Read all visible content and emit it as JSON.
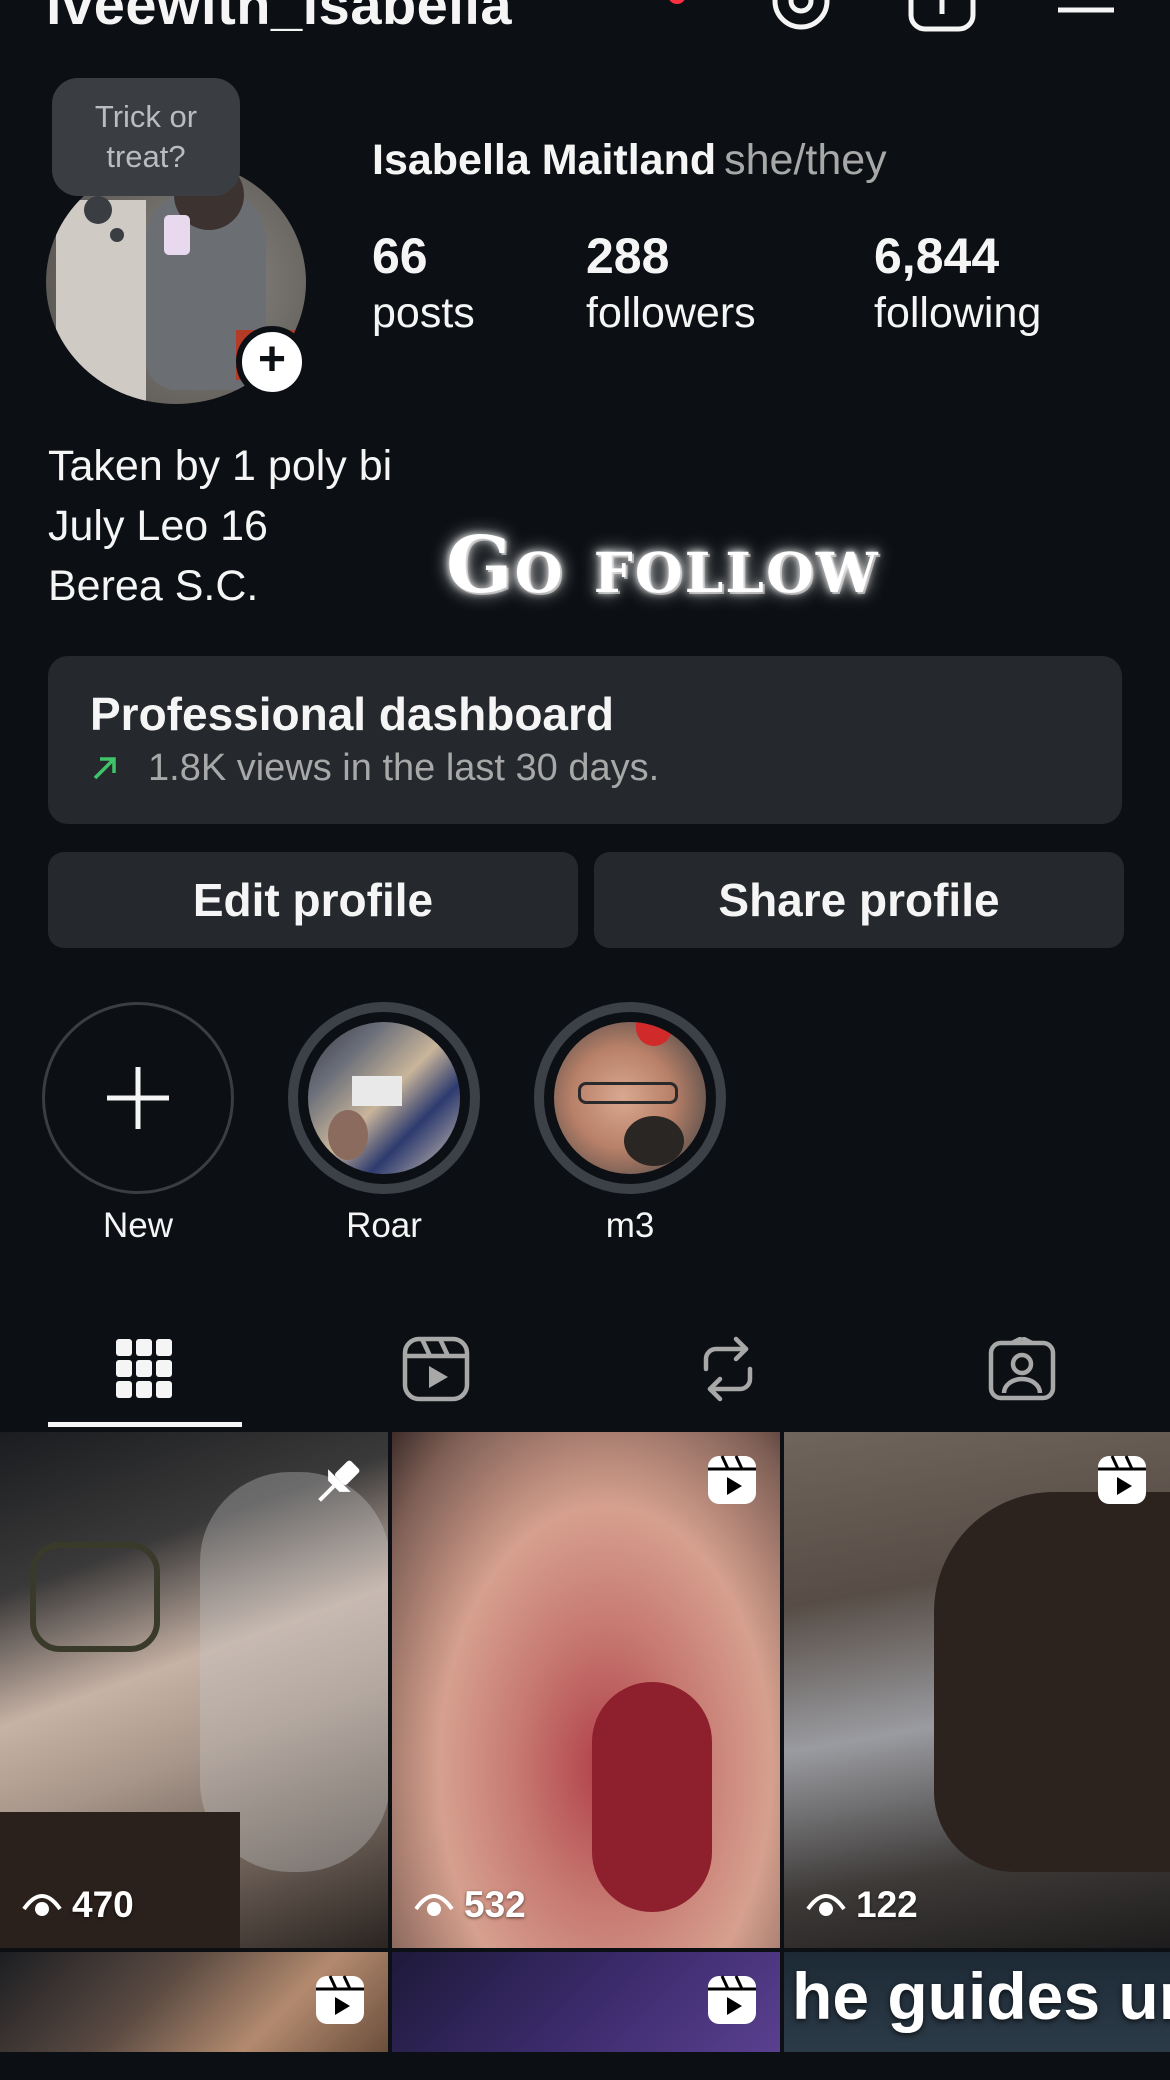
{
  "header": {
    "username": "iveewith_isabella"
  },
  "profile": {
    "note": "Trick or treat?",
    "full_name": "Isabella Maitland",
    "pronouns": "she/they",
    "stats": [
      {
        "value": "66",
        "label": "posts"
      },
      {
        "value": "288",
        "label": "followers"
      },
      {
        "value": "6,844",
        "label": "following"
      }
    ],
    "bio": [
      "Taken by 1 poly bi",
      "July Leo 16",
      "Berea S.C."
    ],
    "banner_text": "Go follow"
  },
  "dashboard": {
    "title": "Professional dashboard",
    "subtitle": "1.8K views in the last 30 days.",
    "trend_color": "#3fc46a"
  },
  "buttons": {
    "edit": "Edit profile",
    "share": "Share profile"
  },
  "highlights": [
    {
      "label": "New",
      "icon": "plus-icon"
    },
    {
      "label": "Roar"
    },
    {
      "label": "m3"
    }
  ],
  "tabs": [
    {
      "icon": "grid-icon",
      "active": true
    },
    {
      "icon": "reels-icon",
      "active": false
    },
    {
      "icon": "reposts-icon",
      "active": false
    },
    {
      "icon": "tagged-icon",
      "active": false
    }
  ],
  "posts": [
    {
      "badge": "pin-icon",
      "views": "470"
    },
    {
      "badge": "reel-icon",
      "views": "532"
    },
    {
      "badge": "reel-icon",
      "views": "122"
    },
    {
      "badge": "reel-icon"
    },
    {
      "badge": "reel-icon"
    },
    {
      "caption": "he guides ur"
    }
  ],
  "colors": {
    "background": "#0c1014",
    "surface": "#25292e",
    "text": "#f5f5f5",
    "muted": "#a8a8a8",
    "notification": "#ff3040"
  }
}
